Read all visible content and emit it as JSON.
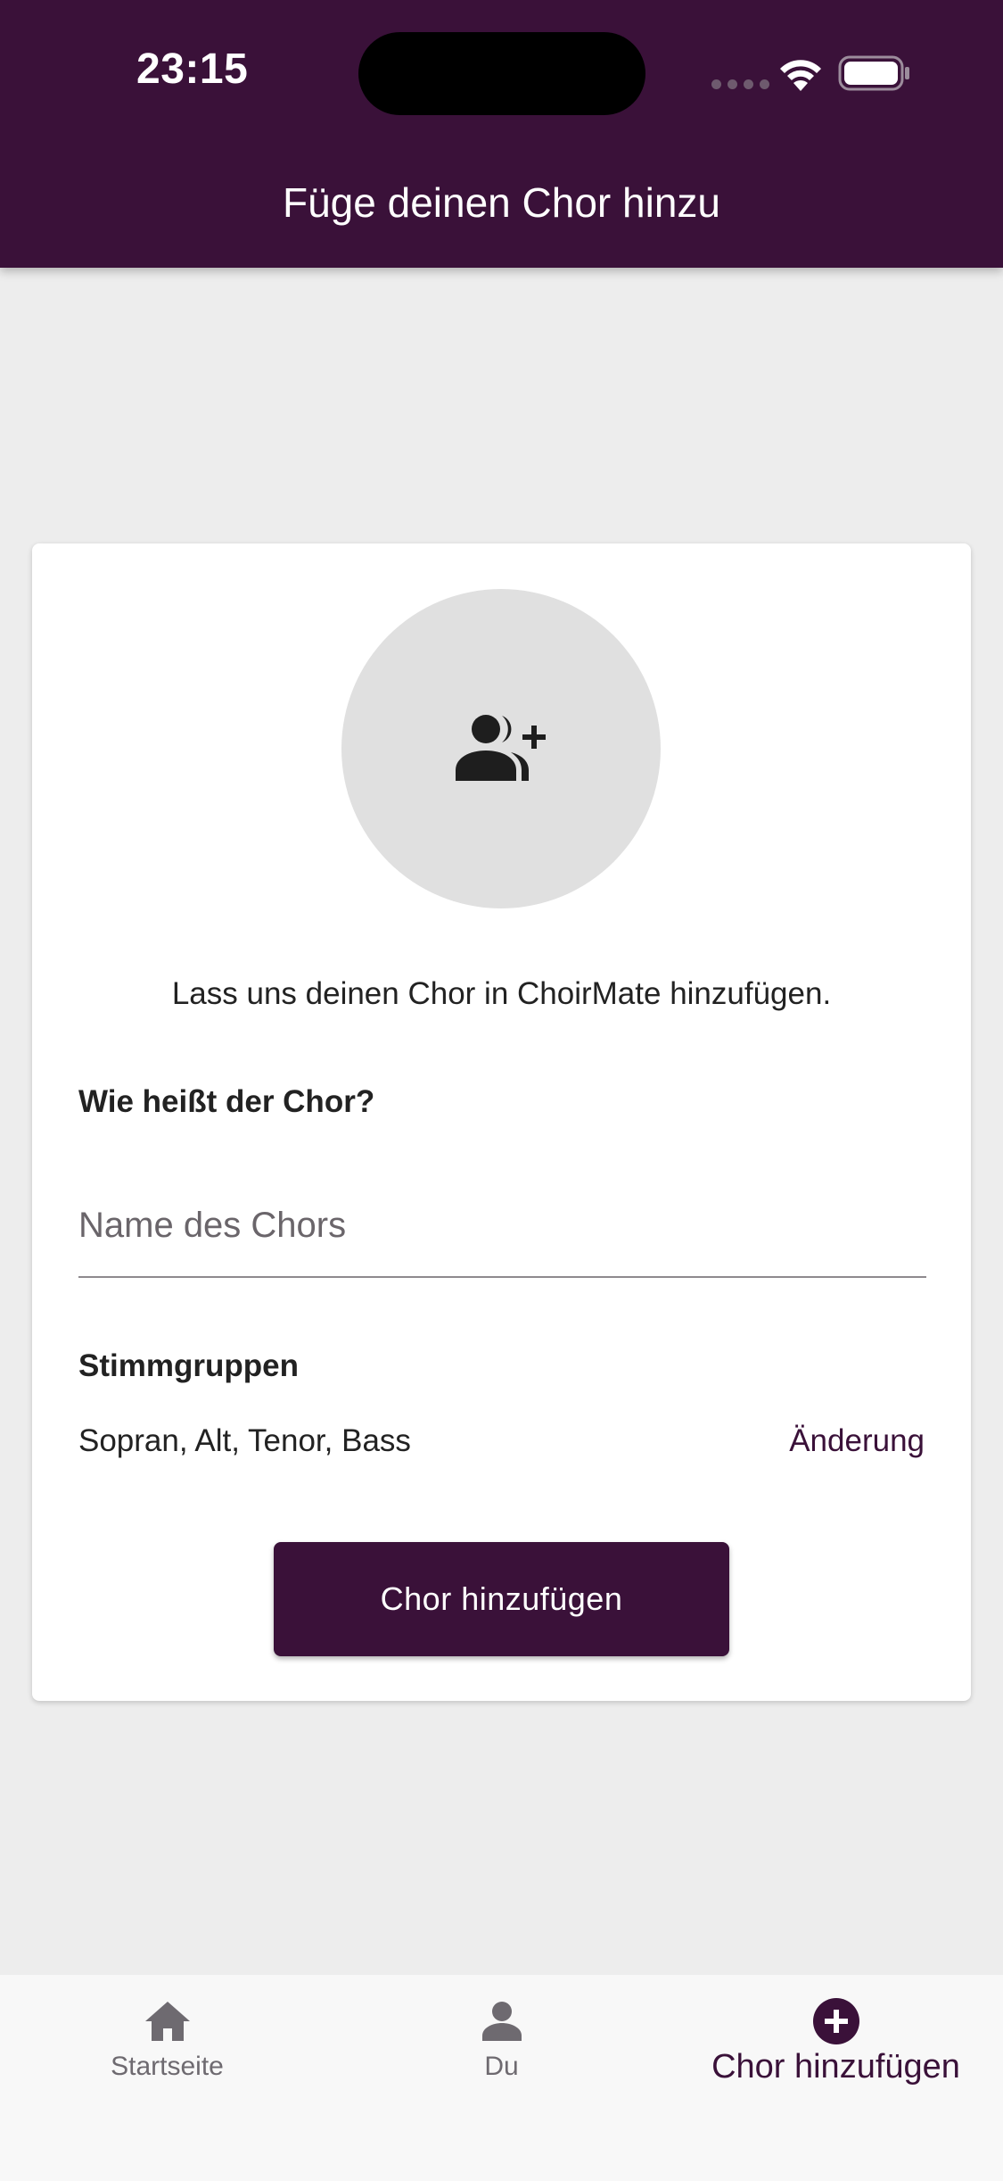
{
  "status_bar": {
    "time": "23:15"
  },
  "header": {
    "title": "Füge deinen Chor hinzu"
  },
  "card": {
    "avatar_icon": "group-add-icon",
    "intro": "Lass uns deinen Chor in ChoirMate hinzufügen.",
    "name_label": "Wie heißt der Chor?",
    "name_placeholder": "Name des Chors",
    "name_value": "",
    "voices_label": "Stimmgruppen",
    "voices_value": "Sopran, Alt, Tenor, Bass",
    "change_label": "Änderung",
    "submit_label": "Chor hinzufügen"
  },
  "bottom_nav": {
    "items": [
      {
        "label": "Startseite",
        "icon": "home-icon",
        "active": false
      },
      {
        "label": "Du",
        "icon": "person-icon",
        "active": false
      },
      {
        "label": "Chor hinzufügen",
        "icon": "add-circle-icon",
        "active": true
      }
    ]
  },
  "colors": {
    "brand": "#3A1139",
    "background": "#EDEDED",
    "inactive_nav": "#6E6A70"
  }
}
